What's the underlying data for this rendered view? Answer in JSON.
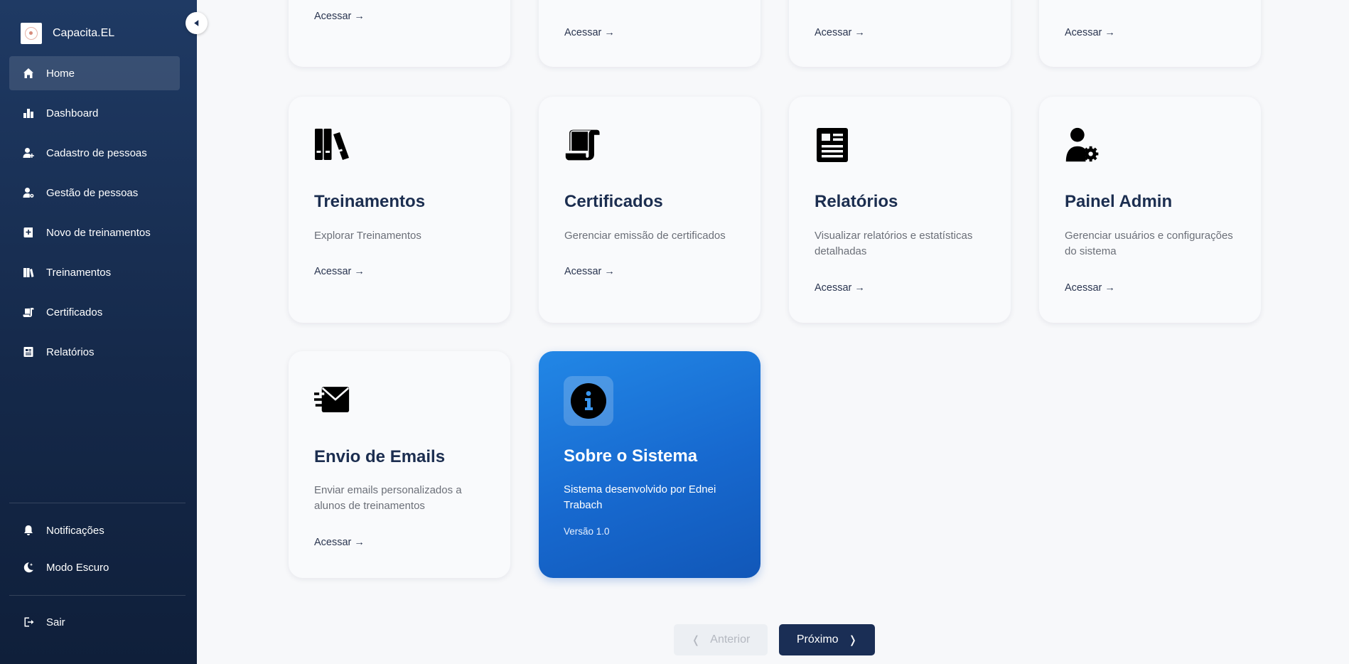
{
  "brand": {
    "name": "Capacita.EL"
  },
  "sidebar": {
    "items": [
      {
        "label": "Home",
        "icon": "home-icon"
      },
      {
        "label": "Dashboard",
        "icon": "bar-chart-icon"
      },
      {
        "label": "Cadastro de pessoas",
        "icon": "user-plus-icon"
      },
      {
        "label": "Gestão de pessoas",
        "icon": "user-gear-icon"
      },
      {
        "label": "Novo de treinamentos",
        "icon": "add-book-icon"
      },
      {
        "label": "Treinamentos",
        "icon": "books-icon"
      },
      {
        "label": "Certificados",
        "icon": "scroll-icon"
      },
      {
        "label": "Relatórios",
        "icon": "report-icon"
      }
    ],
    "bottom": [
      {
        "label": "Notificações",
        "icon": "bell-icon"
      },
      {
        "label": "Modo Escuro",
        "icon": "moon-icon"
      }
    ],
    "logout": {
      "label": "Sair",
      "icon": "logout-icon"
    }
  },
  "top_cards": [
    {
      "link": "Acessar →"
    },
    {
      "link": "Acessar →"
    },
    {
      "link": "Acessar →"
    },
    {
      "link": "Acessar →"
    }
  ],
  "cards": [
    {
      "title": "Treinamentos",
      "description": "Explorar Treinamentos",
      "link": "Acessar →",
      "icon": "books-icon"
    },
    {
      "title": "Certificados",
      "description": "Gerenciar emissão de certificados",
      "link": "Acessar →",
      "icon": "scroll-icon"
    },
    {
      "title": "Relatórios",
      "description": "Visualizar relatórios e estatísticas detalhadas",
      "link": "Acessar →",
      "icon": "report-icon"
    },
    {
      "title": "Painel Admin",
      "description": "Gerenciar usuários e configurações do sistema",
      "link": "Acessar →",
      "icon": "user-gear-icon"
    },
    {
      "title": "Envio de Emails",
      "description": "Enviar emails personalizados a alunos de treinamentos",
      "link": "Acessar →",
      "icon": "fast-envelope-icon"
    }
  ],
  "info_card": {
    "title": "Sobre o Sistema",
    "description": "Sistema desenvolvido por Ednei Trabach",
    "version": "Versão 1.0",
    "icon": "info-circle-icon"
  },
  "pager": {
    "prev_label": "Anterior",
    "next_label": "Próximo",
    "prev_chevron": "❬",
    "next_chevron": "❭"
  },
  "colors": {
    "sidebar_top": "#1f3a64",
    "sidebar_bottom": "#0f1f3a",
    "accent_blue": "#1769cf",
    "title_navy": "#1c2e50"
  }
}
